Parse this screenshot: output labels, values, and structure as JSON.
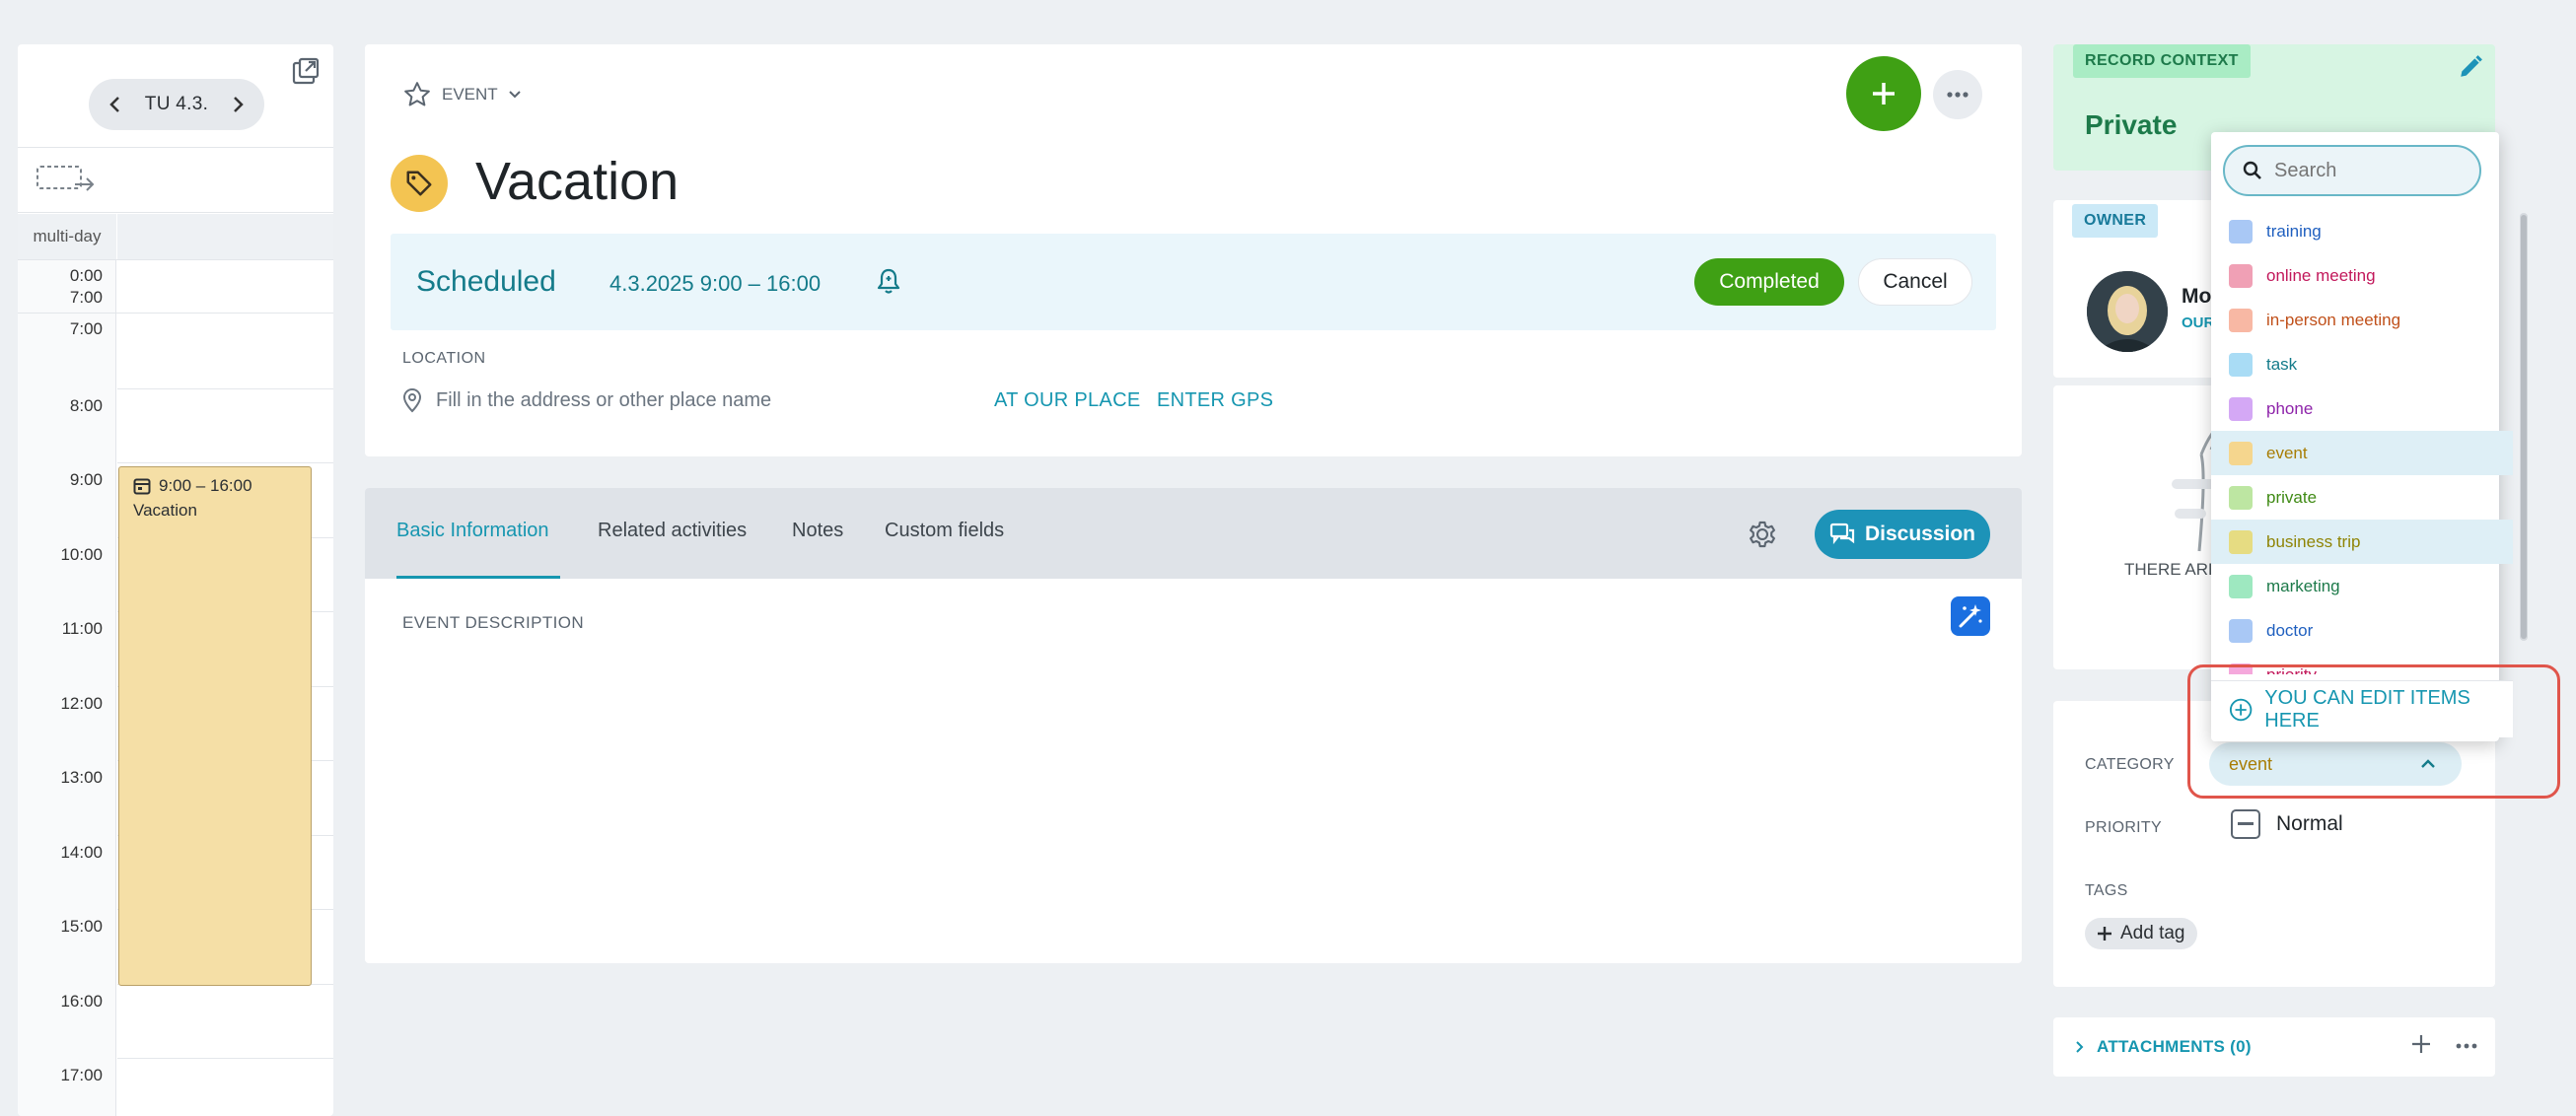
{
  "calendar": {
    "date_label": "TU 4.3.",
    "multiday_label": "multi-day",
    "allday_start": "0:00",
    "allday_end": "7:00",
    "hours": [
      "7:00",
      "8:00",
      "9:00",
      "10:00",
      "11:00",
      "12:00",
      "13:00",
      "14:00",
      "15:00",
      "16:00",
      "17:00"
    ],
    "event": {
      "time": "9:00 – 16:00",
      "title": "Vacation",
      "color": "#f5dfa6"
    }
  },
  "record": {
    "type_label": "EVENT",
    "title": "Vacation",
    "status": "Scheduled",
    "datetime": "4.3.2025 9:00 – 16:00",
    "completed_label": "Completed",
    "cancel_label": "Cancel",
    "location_heading": "LOCATION",
    "location_placeholder": "Fill in the address or other place name",
    "at_our_place": "AT OUR PLACE",
    "enter_gps": "ENTER GPS"
  },
  "tabs": {
    "items": [
      "Basic Information",
      "Related activities",
      "Notes",
      "Custom fields"
    ],
    "active": "Basic Information",
    "discussion_label": "Discussion",
    "description_heading": "EVENT DESCRIPTION"
  },
  "sidebar": {
    "context_badge": "RECORD CONTEXT",
    "context_value": "Private",
    "owner_badge": "OWNER",
    "owner_name": "Mo",
    "owner_sub": "OUR",
    "empty_text": "THERE ARE",
    "category_label": "CATEGORY",
    "category_value": "event",
    "priority_label": "PRIORITY",
    "priority_value": "Normal",
    "tags_label": "TAGS",
    "add_tag": "Add tag",
    "attachments": "ATTACHMENTS (0)"
  },
  "dropdown": {
    "search_placeholder": "Search",
    "items": [
      {
        "label": "training",
        "swatch": "#a9c8f5",
        "text": "#1f5fbf"
      },
      {
        "label": "online meeting",
        "swatch": "#f0a0b5",
        "text": "#c2185b"
      },
      {
        "label": "in-person meeting",
        "swatch": "#f8b8a4",
        "text": "#c0501a"
      },
      {
        "label": "task",
        "swatch": "#a9dcf5",
        "text": "#147b8a"
      },
      {
        "label": "phone",
        "swatch": "#d4a8f5",
        "text": "#8e24aa"
      },
      {
        "label": "event",
        "swatch": "#f5d68e",
        "text": "#a87d05"
      },
      {
        "label": "private",
        "swatch": "#bde6a2",
        "text": "#3f8a14"
      },
      {
        "label": "business trip",
        "swatch": "#e6dc82",
        "text": "#8f8405"
      },
      {
        "label": "marketing",
        "swatch": "#9ee8c0",
        "text": "#1d7a4a"
      },
      {
        "label": "doctor",
        "swatch": "#a9c8f5",
        "text": "#1f5fbf"
      },
      {
        "label": "priority",
        "swatch": "#f5a8dc",
        "text": "#c2185b"
      }
    ],
    "highlighted": [
      "event",
      "business trip"
    ],
    "edit_items": "YOU CAN EDIT ITEMS HERE"
  }
}
